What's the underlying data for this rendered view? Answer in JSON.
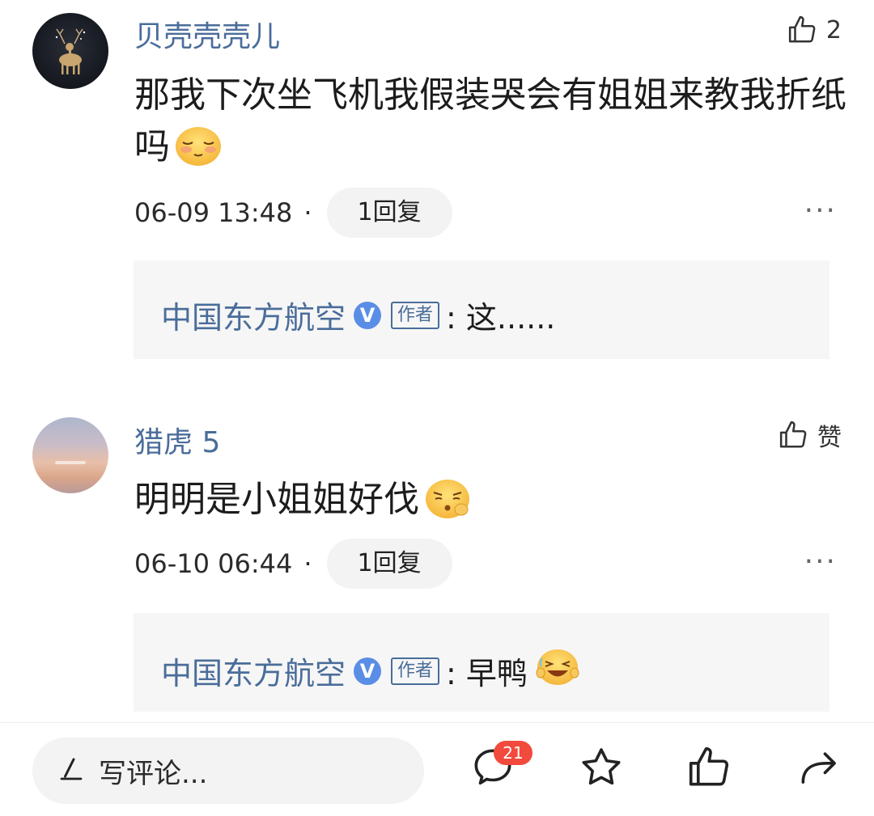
{
  "comments": [
    {
      "username": "贝壳壳壳儿",
      "like_count": "2",
      "text": "那我下次坐飞机我假装哭会有姐姐来教我折纸吗",
      "timestamp": "06-09 13:48",
      "separator": "·",
      "reply_label": "1回复",
      "more": "···",
      "reply": {
        "author": "中国东方航空",
        "verified": "V",
        "tag": "作者",
        "text": ": 这......"
      }
    },
    {
      "username": "猎虎 5",
      "like_label": "赞",
      "text": "明明是小姐姐好伐",
      "timestamp": "06-10 06:44",
      "separator": "·",
      "reply_label": "1回复",
      "more": "···",
      "reply": {
        "author": "中国东方航空",
        "verified": "V",
        "tag": "作者",
        "text": ": 早鸭"
      }
    }
  ],
  "bottom_bar": {
    "input_placeholder": "写评论...",
    "comment_count_badge": "21",
    "icons": [
      "pen-icon",
      "comment-bubble-icon",
      "star-icon",
      "thumb-up-icon",
      "share-arrow-icon"
    ]
  },
  "colors": {
    "username": "#4a6d9a",
    "badge": "#f24a3c",
    "verified": "#5a8ee6"
  }
}
